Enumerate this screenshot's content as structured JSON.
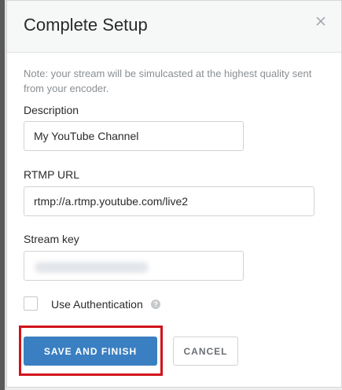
{
  "modal": {
    "title": "Complete Setup",
    "note": "Note: your stream will be simulcasted at the highest quality sent from your encoder."
  },
  "form": {
    "description": {
      "label": "Description",
      "value": "My YouTube Channel"
    },
    "rtmp_url": {
      "label": "RTMP URL",
      "value": "rtmp://a.rtmp.youtube.com/live2"
    },
    "stream_key": {
      "label": "Stream key",
      "value": ""
    },
    "use_authentication": {
      "label": "Use Authentication",
      "checked": false,
      "help_icon": "question-circle-icon"
    }
  },
  "actions": {
    "save_label": "SAVE AND FINISH",
    "cancel_label": "CANCEL"
  },
  "colors": {
    "primary": "#3a7fc1",
    "highlight": "#d0121b",
    "header_bg": "#f6f7f7",
    "muted_text": "#8a8f93"
  }
}
